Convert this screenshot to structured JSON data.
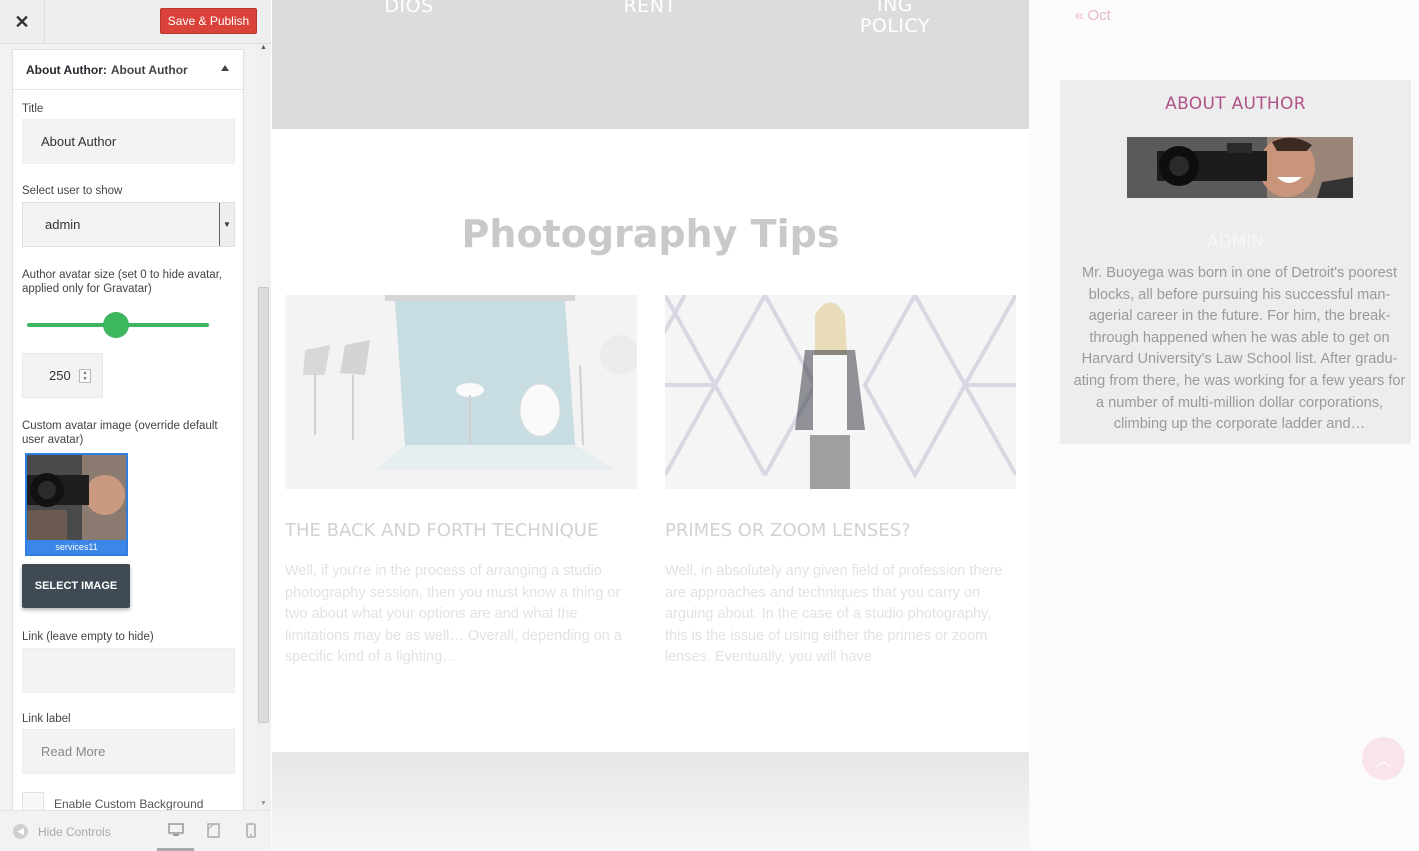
{
  "topbar": {
    "close_glyph": "✕",
    "publish_label": "Save & Publish"
  },
  "widget": {
    "header_prefix": "About Author:",
    "header_name": "About Author",
    "title_label": "Title",
    "title_value": "About Author",
    "user_label": "Select user to show",
    "user_value": "admin",
    "avatar_size_label": "Author avatar size (set 0 to hide avatar, applied only for Gravatar)",
    "avatar_size_fraction": 0.49,
    "avatar_size_value": "250",
    "custom_avatar_label": "Custom avatar image (override default user avatar)",
    "avatar_filename": "services11",
    "select_image_label": "SELECT IMAGE",
    "link_label": "Link (leave empty to hide)",
    "link_value": "",
    "link_text_label": "Link label",
    "link_text_value": "Read More",
    "custom_bg_label": "Enable Custom Background"
  },
  "footer": {
    "hide_controls_label": "Hide Controls"
  },
  "preview": {
    "hero_items": [
      "DIOS",
      "RENT",
      "ING\nPOLICY"
    ],
    "section_title": "Photography Tips",
    "posts": [
      {
        "title": "THE BACK AND FORTH TECHNIQUE",
        "excerpt": "Well, if you're in the process of arranging a studio photography session, then you must know a thing or two about what your options are and what the limitations may be as well… Overall, depending on a specific kind of a lighting…"
      },
      {
        "title": "PRIMES OR ZOOM LENSES?",
        "excerpt": "Well, in absolutely any given field of profession there are approaches and techniques that you carry on arguing about. In the case of a studio photography, this is the issue of using either the primes or zoom lenses. Eventually, you will have"
      }
    ],
    "prev_month": "« Oct",
    "author_heading": "ABOUT AUTHOR",
    "author_name": "ADMIN",
    "author_bio": "Mr. Buoyega was born in one of Detroit's poorest blocks, all before pursuing his successful man-agerial career in the future. For him, the break-through happened when he was able to get on Harvard University's Law School list. After gradu-ating from there, he was working for a few years for a number of multi-million dollar corporations, climbing up the corporate ladder and…"
  },
  "colors": {
    "accent_green": "#3cb75d",
    "publish_red": "#d9433a",
    "author_heading": "#b05388",
    "select_blue": "#3b86e6"
  },
  "icons": [
    "close-icon",
    "caret-up-icon",
    "dropdown-arrow-icon",
    "stepper-icon",
    "hide-controls-icon",
    "desktop-icon",
    "tablet-icon",
    "mobile-icon",
    "scroll-top-icon"
  ]
}
